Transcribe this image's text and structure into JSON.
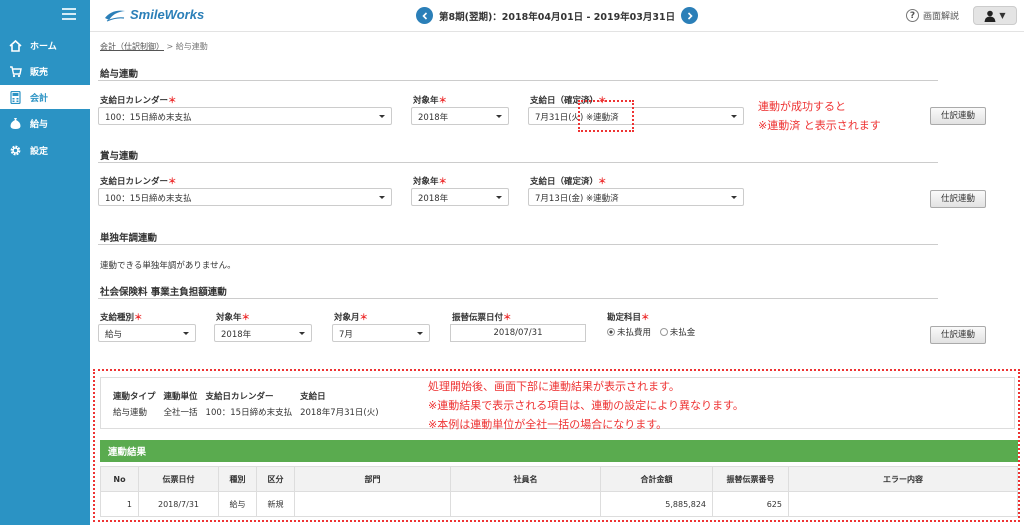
{
  "app": {
    "logo": "SmileWorks"
  },
  "header": {
    "period": "第8期(翌期)：2018年04月01日 - 2019年03月31日",
    "help": "画面解説"
  },
  "sidebar": {
    "items": [
      {
        "label": "ホーム",
        "icon": "home-icon"
      },
      {
        "label": "販売",
        "icon": "cart-icon"
      },
      {
        "label": "会計",
        "icon": "calculator-icon"
      },
      {
        "label": "給与",
        "icon": "money-bag-icon"
      },
      {
        "label": "設定",
        "icon": "gear-icon"
      }
    ]
  },
  "breadcrumb": {
    "parent": "会計（仕訳制御）",
    "sep": ">",
    "current": "給与連動"
  },
  "salary": {
    "title": "給与連動",
    "cal_label": "支給日カレンダー",
    "cal_value": "100：15日締め末支払",
    "year_label": "対象年",
    "year_value": "2018年",
    "day_label": "支給日（確定済）",
    "day_value": "7月31日(火) ※連動済",
    "button": "仕訳連動"
  },
  "bonus": {
    "title": "賞与連動",
    "cal_label": "支給日カレンダー",
    "cal_value": "100：15日締め末支払",
    "year_label": "対象年",
    "year_value": "2018年",
    "day_label": "支給日（確定済）",
    "day_value": "7月13日(金) ※連動済",
    "button": "仕訳連動"
  },
  "annual": {
    "title": "単独年調連動",
    "message": "連動できる単独年調がありません。"
  },
  "social": {
    "title": "社会保険料 事業主負担額連動",
    "kind_label": "支給種別",
    "kind_value": "給与",
    "year_label": "対象年",
    "year_value": "2018年",
    "month_label": "対象月",
    "month_value": "7月",
    "date_label": "振替伝票日付",
    "date_value": "2018/07/31",
    "account_label": "勘定科目",
    "opt1": "未払費用",
    "opt2": "未払金",
    "button": "仕訳連動"
  },
  "notes": {
    "n1a": "連動が成功すると",
    "n1b": "※連動済 と表示されます",
    "n2a": "処理開始後、画面下部に連動結果が表示されます。",
    "n2b": "※連動結果で表示される項目は、連動の設定により異なります。",
    "n2c": "※本例は連動単位が全社一括の場合になります。"
  },
  "summary": {
    "headers": [
      "連動タイプ",
      "連動単位",
      "支給日カレンダー",
      "支給日"
    ],
    "values": [
      "給与連動",
      "全社一括",
      "100：15日締め末支払",
      "2018年7月31日(火)"
    ]
  },
  "results": {
    "title": "連動結果",
    "headers": [
      "No",
      "伝票日付",
      "種別",
      "区分",
      "部門",
      "社員名",
      "合計金額",
      "振替伝票番号",
      "エラー内容"
    ],
    "row": [
      "1",
      "2018/7/31",
      "給与",
      "新規",
      "",
      "",
      "5,885,824",
      "625",
      ""
    ]
  },
  "colors": {
    "sidebar": "#2b93c4",
    "result_bar": "#5aab4f",
    "note": "#e33333"
  }
}
